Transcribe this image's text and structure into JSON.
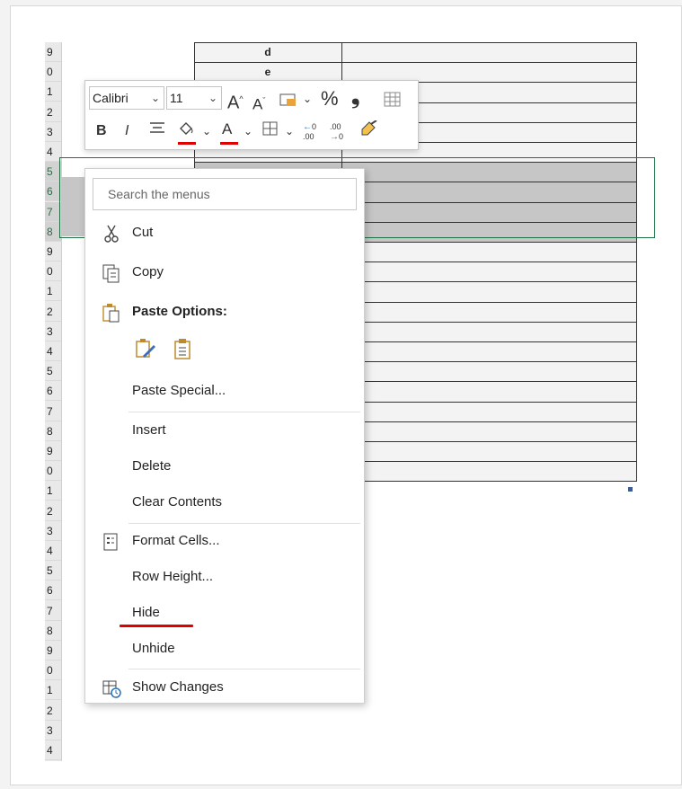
{
  "grid": {
    "row_numbers": [
      "9",
      "0",
      "1",
      "2",
      "3",
      "4",
      "5",
      "6",
      "7",
      "8",
      "9",
      "0",
      "1",
      "2",
      "3",
      "4",
      "5",
      "6",
      "7",
      "8",
      "9",
      "0",
      "1",
      "2",
      "3",
      "4",
      "5",
      "6",
      "7",
      "8",
      "9",
      "0",
      "1",
      "2",
      "3",
      "4"
    ],
    "cell_labels": [
      "d",
      "e",
      "",
      "",
      "",
      "",
      ":"
    ]
  },
  "mini_toolbar": {
    "font_name": "Calibri",
    "font_size": "11",
    "grow_font": "A",
    "shrink_font": "A",
    "percent": "%",
    "comma": "❟",
    "bold": "B",
    "italic": "I",
    "font_color": "A",
    "increase_decimal": ".00",
    "decrease_decimal": ".00",
    "accent_underline_color": "#e00000"
  },
  "context_menu": {
    "search_placeholder": "Search the menus",
    "cut": "Cut",
    "copy": "Copy",
    "paste_options": "Paste Options:",
    "paste_special": "Paste Special...",
    "insert": "Insert",
    "delete": "Delete",
    "clear_contents": "Clear Contents",
    "format_cells": "Format Cells...",
    "row_height": "Row Height...",
    "hide": "Hide",
    "unhide": "Unhide",
    "show_changes": "Show Changes"
  },
  "colors": {
    "selection_border": "#217346",
    "annotation_red": "#e00000"
  }
}
